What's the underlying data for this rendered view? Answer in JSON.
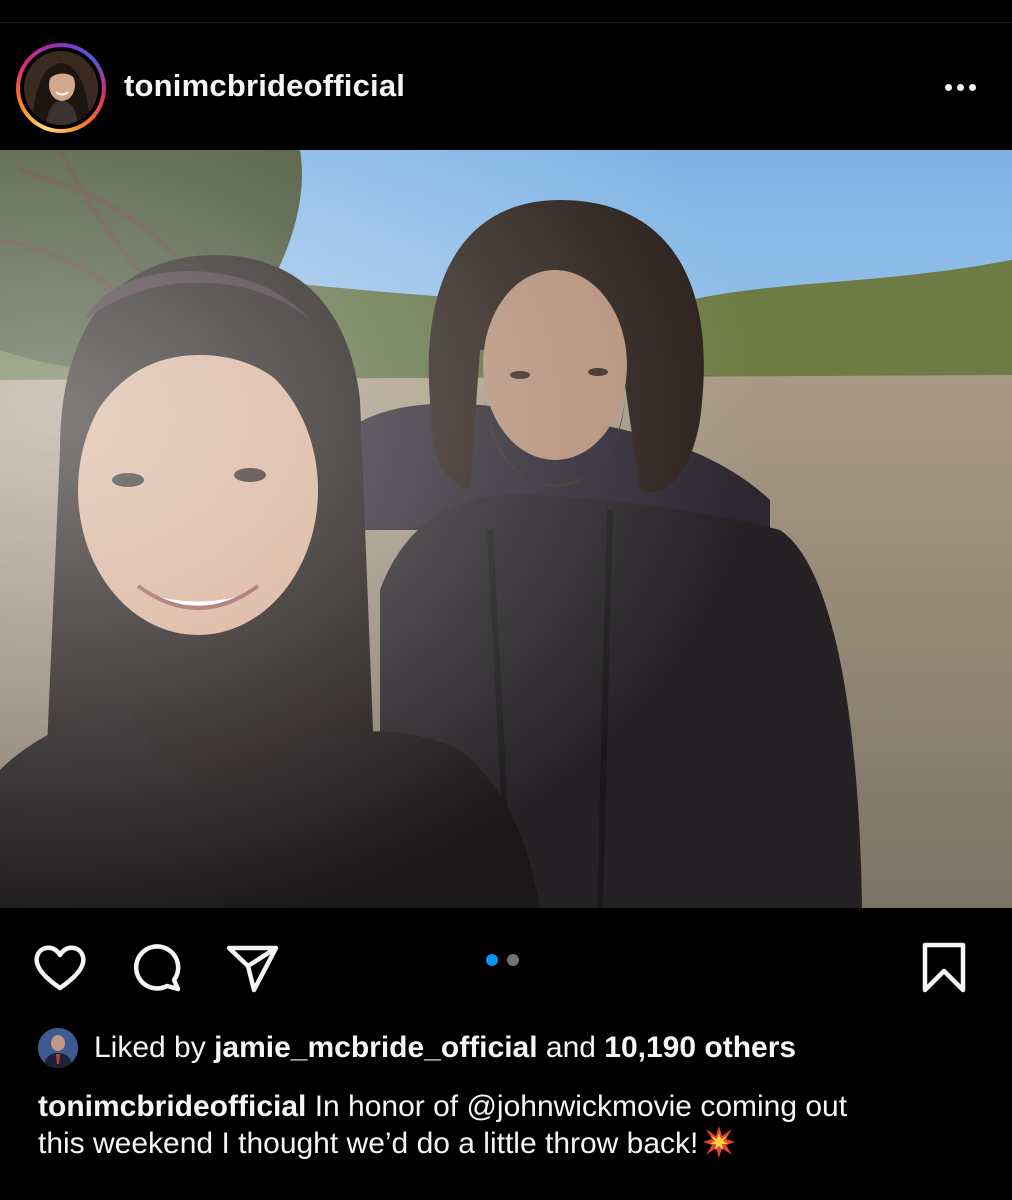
{
  "post": {
    "username": "tonimcbrideofficial",
    "photo_alt": "",
    "carousel": {
      "current": 1,
      "total": 2,
      "active_color": "#0095f6",
      "inactive_color": "#737373"
    }
  },
  "icons": {
    "more": "more-horizontal-icon",
    "like": "heart-icon",
    "comment": "comment-bubble-icon",
    "share": "paper-plane-icon",
    "save": "bookmark-icon"
  },
  "likes": {
    "prefix": "Liked by ",
    "user": "jamie_mcbride_official",
    "middle": " and ",
    "count": "10,190 others"
  },
  "caption": {
    "user": "tonimcbrideofficial",
    "line1": " In honor of @johnwickmovie coming out",
    "line2": "this weekend I thought we’d do a little throw back!",
    "emoji": "collision-emoji"
  }
}
